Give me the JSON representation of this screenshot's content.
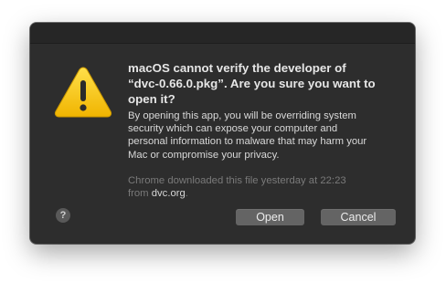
{
  "dialog": {
    "icon": "warning-triangle-icon",
    "title_line1": "macOS cannot verify the developer of",
    "title_line2": "“dvc-0.66.0.pkg”. Are you sure you want to",
    "title_line3": "open it?",
    "body_line1": "By opening this app, you will be overriding system",
    "body_line2": "security which can expose your computer and",
    "body_line3": "personal information to malware that may harm your",
    "body_line4": "Mac or compromise your privacy.",
    "source_line1": "Chrome downloaded this file yesterday at 22:23",
    "source_from": "from ",
    "source_domain": "dvc.org",
    "source_end": ".",
    "help_label": "?",
    "open_label": "Open",
    "cancel_label": "Cancel"
  },
  "colors": {
    "dialog_bg": "#2d2d2d",
    "warning_yellow": "#f5c518",
    "button_bg": "#646464"
  }
}
